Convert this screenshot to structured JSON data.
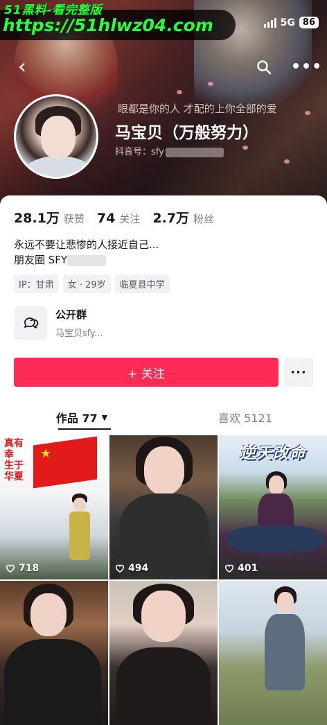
{
  "watermark": {
    "brand": "51黑料-看完整版",
    "url": "https://51hlwz04.com"
  },
  "status_bar": {
    "network": "5G",
    "battery": "86"
  },
  "banner": {
    "overlay_text": "眼都是你的人 才配的上你全部的爱"
  },
  "profile": {
    "name": "马宝贝（万般努力）",
    "douyin_id_label": "抖音号：sfy"
  },
  "stats": [
    {
      "num": "28.1万",
      "label": "获赞"
    },
    {
      "num": "74",
      "label": "关注"
    },
    {
      "num": "2.7万",
      "label": "粉丝"
    }
  ],
  "bio": {
    "line1": "永远不要让悲惨的人接近自己...",
    "line2": "朋友圈 SFY"
  },
  "tags": [
    "IP：甘肃",
    "女 · 29岁",
    "临夏县中学"
  ],
  "group": {
    "title": "公开群",
    "subtitle": "马宝贝sfy..."
  },
  "actions": {
    "follow_label": "+ 关注",
    "more_label": "···"
  },
  "tabs": [
    {
      "label": "作品 77",
      "active": true
    },
    {
      "label": "喜欢 5121",
      "active": false
    }
  ],
  "videos": [
    {
      "likes": "718",
      "overlay_text": "真有幸 生于华夏"
    },
    {
      "likes": "494",
      "overlay_text": ""
    },
    {
      "likes": "401",
      "overlay_text": "逆天改命"
    },
    {
      "likes": "",
      "overlay_text": ""
    },
    {
      "likes": "",
      "overlay_text": ""
    },
    {
      "likes": "",
      "overlay_text": ""
    }
  ],
  "colors": {
    "accent": "#fe2c55",
    "watermark_green": "#26ff3a",
    "text_primary": "#161823",
    "text_secondary": "#7a7c85"
  },
  "icons": [
    "back-arrow-icon",
    "search-icon",
    "more-dots-icon",
    "group-chat-icon",
    "heart-icon",
    "dropdown-triangle-icon"
  ]
}
